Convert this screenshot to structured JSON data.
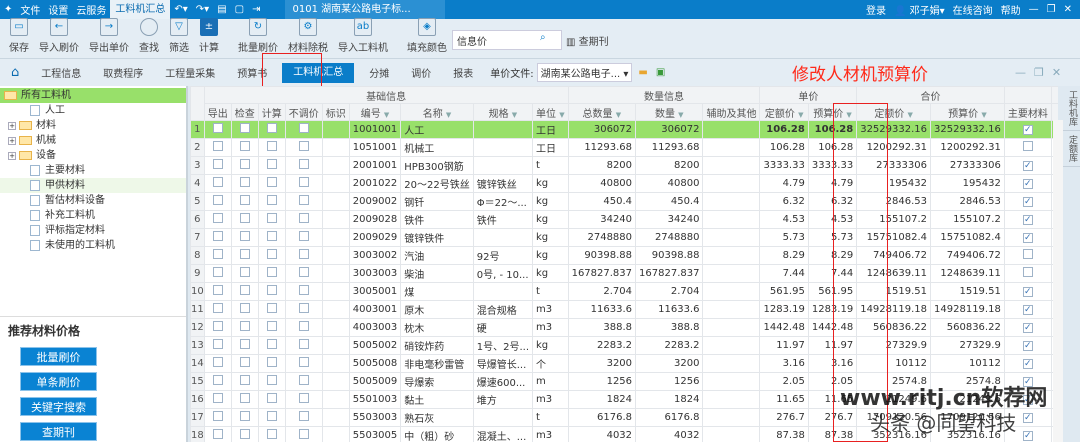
{
  "titlebar": {
    "menus": [
      "文件",
      "设置",
      "云服务"
    ],
    "active": "工料机汇总",
    "doc": "0101 湖南某公路电子标...",
    "right": [
      "登录",
      "邓子娟",
      "在线咨询",
      "帮助"
    ]
  },
  "toolbar": {
    "buttons": [
      "保存",
      "导入刷价",
      "导出单价",
      "查找",
      "筛选",
      "计算",
      "批量刷价",
      "材料除税",
      "导入工料机",
      "填充颜色"
    ],
    "info_value": "信息价",
    "journal": "查期刊"
  },
  "tabs": [
    "工程信息",
    "取费程序",
    "工程量采集",
    "预算书",
    "工料机汇总",
    "分摊",
    "调价",
    "报表"
  ],
  "price_file": {
    "label": "单价文件:",
    "value": "湖南某公路电子..."
  },
  "annotation": "修改人材机预算价",
  "tree": [
    {
      "label": "所有工料机",
      "type": "folder-open",
      "level": 0
    },
    {
      "label": "人工",
      "type": "file"
    },
    {
      "label": "材料",
      "type": "folder",
      "expand": true
    },
    {
      "label": "机械",
      "type": "folder",
      "expand": true
    },
    {
      "label": "设备",
      "type": "folder",
      "expand": true
    },
    {
      "label": "主要材料",
      "type": "file"
    },
    {
      "label": "甲供材料",
      "type": "file",
      "selected": true
    },
    {
      "label": "暂估材料设备",
      "type": "file"
    },
    {
      "label": "补充工料机",
      "type": "file"
    },
    {
      "label": "评标指定材料",
      "type": "file"
    },
    {
      "label": "未使用的工料机",
      "type": "file"
    }
  ],
  "recommend": {
    "title": "推荐材料价格",
    "buttons": [
      "批量刷价",
      "单条刷价",
      "关键字搜索",
      "查期刊"
    ]
  },
  "grid": {
    "groups": [
      "基础信息",
      "数量信息",
      "单价",
      "合价"
    ],
    "columns": [
      "导出",
      "检查",
      "计算",
      "不调价",
      "标识",
      "编号",
      "名称",
      "规格",
      "单位",
      "总数量",
      "数量",
      "辅助及其他",
      "定额价",
      "预算价",
      "定额价",
      "预算价",
      "主要材料"
    ],
    "rows": [
      [
        "1001001",
        "人工",
        "",
        "工日",
        "306072",
        "306072",
        "",
        "106.28",
        "106.28",
        "32529332.16",
        "32529332.16",
        true
      ],
      [
        "1051001",
        "机械工",
        "",
        "工日",
        "11293.68",
        "11293.68",
        "",
        "106.28",
        "106.28",
        "1200292.31",
        "1200292.31",
        false
      ],
      [
        "2001001",
        "HPB300钢筋",
        "",
        "t",
        "8200",
        "8200",
        "",
        "3333.33",
        "3333.33",
        "27333306",
        "27333306",
        true
      ],
      [
        "2001022",
        "20～22号铁丝",
        "镀锌铁丝",
        "kg",
        "40800",
        "40800",
        "",
        "4.79",
        "4.79",
        "195432",
        "195432",
        true
      ],
      [
        "2009002",
        "钢钎",
        "Φ＝22～...",
        "kg",
        "450.4",
        "450.4",
        "",
        "6.32",
        "6.32",
        "2846.53",
        "2846.53",
        true
      ],
      [
        "2009028",
        "铁件",
        "铁件",
        "kg",
        "34240",
        "34240",
        "",
        "4.53",
        "4.53",
        "155107.2",
        "155107.2",
        true
      ],
      [
        "2009029",
        "镀锌铁件",
        "",
        "kg",
        "2748880",
        "2748880",
        "",
        "5.73",
        "5.73",
        "15751082.4",
        "15751082.4",
        true
      ],
      [
        "3003002",
        "汽油",
        "92号",
        "kg",
        "90398.88",
        "90398.88",
        "",
        "8.29",
        "8.29",
        "749406.72",
        "749406.72",
        false
      ],
      [
        "3003003",
        "柴油",
        "0号, - 10...",
        "kg",
        "167827.837",
        "167827.837",
        "",
        "7.44",
        "7.44",
        "1248639.11",
        "1248639.11",
        false
      ],
      [
        "3005001",
        "煤",
        "",
        "t",
        "2.704",
        "2.704",
        "",
        "561.95",
        "561.95",
        "1519.51",
        "1519.51",
        true
      ],
      [
        "4003001",
        "原木",
        "混合规格",
        "m3",
        "11633.6",
        "11633.6",
        "",
        "1283.19",
        "1283.19",
        "14928119.18",
        "14928119.18",
        true
      ],
      [
        "4003003",
        "枕木",
        "硬",
        "m3",
        "388.8",
        "388.8",
        "",
        "1442.48",
        "1442.48",
        "560836.22",
        "560836.22",
        true
      ],
      [
        "5005002",
        "硝铵炸药",
        "1号、2号...",
        "kg",
        "2283.2",
        "2283.2",
        "",
        "11.97",
        "11.97",
        "27329.9",
        "27329.9",
        true
      ],
      [
        "5005008",
        "非电毫秒雷管",
        "导爆管长...",
        "个",
        "3200",
        "3200",
        "",
        "3.16",
        "3.16",
        "10112",
        "10112",
        true
      ],
      [
        "5005009",
        "导爆索",
        "爆速600...",
        "m",
        "1256",
        "1256",
        "",
        "2.05",
        "2.05",
        "2574.8",
        "2574.8",
        true
      ],
      [
        "5501003",
        "黏土",
        "堆方",
        "m3",
        "1824",
        "1824",
        "",
        "11.65",
        "11.65",
        "21249.6",
        "21249.6",
        true
      ],
      [
        "5503003",
        "熟石灰",
        "",
        "t",
        "6176.8",
        "6176.8",
        "",
        "276.7",
        "276.7",
        "1709120.56",
        "1709120.56",
        true
      ],
      [
        "5503005",
        "中（粗）砂",
        "混凝土、...",
        "m3",
        "4032",
        "4032",
        "",
        "87.38",
        "87.38",
        "352316.16",
        "352316.16",
        true
      ]
    ]
  },
  "side_tabs": [
    "工料机库",
    "定额库"
  ],
  "watermark": [
    "www.ritj.cn软荐网",
    "头条 @同望科技"
  ]
}
